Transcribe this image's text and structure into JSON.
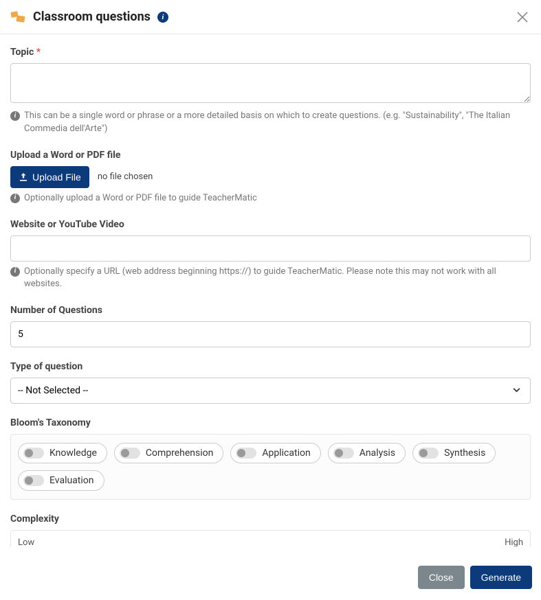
{
  "header": {
    "title": "Classroom questions"
  },
  "form": {
    "topic": {
      "label": "Topic",
      "help": "This can be a single word or phrase or a more detailed basis on which to create questions. (e.g. \"Sustainability\", \"The Italian Commedia dell'Arte\")"
    },
    "upload": {
      "label": "Upload a Word or PDF file",
      "button": "Upload File",
      "status": "no file chosen",
      "help": "Optionally upload a Word or PDF file to guide TeacherMatic"
    },
    "website": {
      "label": "Website or YouTube Video",
      "help": "Optionally specify a URL (web address beginning https://) to guide TeacherMatic. Please note this may not work with all websites."
    },
    "num_questions": {
      "label": "Number of Questions",
      "value": "5"
    },
    "type": {
      "label": "Type of question",
      "selected": "-- Not Selected --"
    },
    "bloom": {
      "label": "Bloom's Taxonomy",
      "options": [
        "Knowledge",
        "Comprehension",
        "Application",
        "Analysis",
        "Synthesis",
        "Evaluation"
      ]
    },
    "complexity": {
      "label": "Complexity",
      "low": "Low",
      "high": "High"
    }
  },
  "footer": {
    "close": "Close",
    "generate": "Generate"
  }
}
